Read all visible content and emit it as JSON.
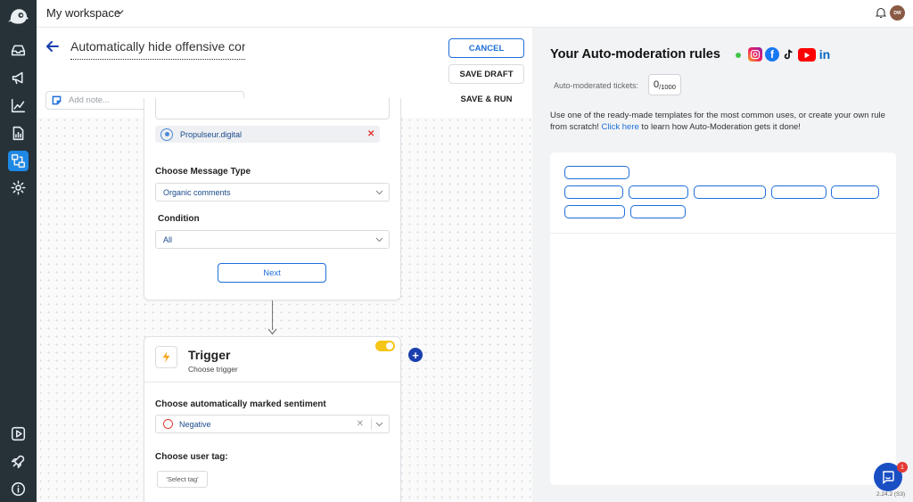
{
  "workspace": {
    "name": "My workspace",
    "user_initials": "DW"
  },
  "editor": {
    "rule_title": "Automatically hide offensive comm",
    "note_placeholder": "Add note...",
    "cancel_label": "CANCEL",
    "save_draft_label": "SAVE DRAFT",
    "save_run_label": "SAVE & RUN"
  },
  "source_card": {
    "selected_page": "Propulseur.digital",
    "message_type_label": "Choose Message Type",
    "message_type_value": "Organic comments",
    "condition_label": "Condition",
    "condition_value": "All",
    "next_label": "Next"
  },
  "trigger_card": {
    "title": "Trigger",
    "subtitle": "Choose trigger",
    "enabled": true,
    "sentiment_label": "Choose automatically marked sentiment",
    "sentiment_value": "Negative",
    "user_tag_label": "Choose user tag:",
    "select_tag_label": "'Select tag'"
  },
  "right_panel": {
    "title": "Your Auto-moderation rules",
    "socials": [
      "instagram-icon",
      "facebook-icon",
      "tiktok-icon",
      "youtube-icon",
      "linkedin-icon"
    ],
    "counter_label": "Auto-moderated tickets:",
    "counter_value": "0",
    "counter_max": "/1000",
    "desc_prefix": "Use one of the ready-made templates for the most common uses, or create your own rule from scratch!",
    "desc_link": "Click here",
    "desc_suffix": " to learn how Auto-Moderation gets it done!"
  },
  "version": "2.24.2 (S3)",
  "chat_badge": "1",
  "colors": {
    "sidebar": "#263238",
    "accent": "#1e6fd9",
    "active": "#1e88e5",
    "toggle": "#f5c518",
    "status_dot": "#43c548"
  }
}
